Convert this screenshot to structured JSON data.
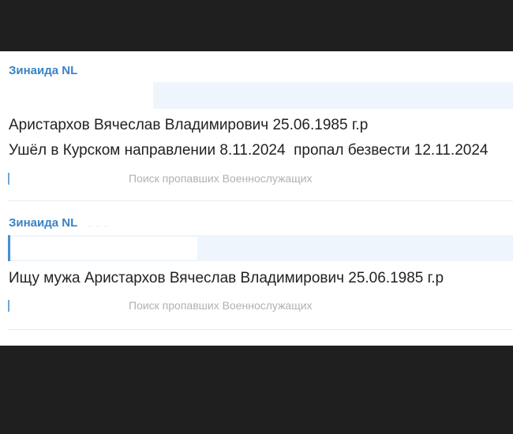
{
  "messages": [
    {
      "author": "Зинаида NL",
      "lines": [
        "Аристархов Вячеслав Владимирович 25.06.1985 г.р",
        "Ушёл в Курском направлении 8.11.2024  пропал безвести 12.11.2024"
      ],
      "source": "Поиск пропавших Военнослужащих"
    },
    {
      "author": "Зинаида NL",
      "lines": [
        "Ищу мужа Аристархов Вячеслав Владимирович 25.06.1985 г.р"
      ],
      "source": "Поиск пропавших Военнослужащих"
    }
  ],
  "colors": {
    "author": "#3a83c4",
    "quote_background": "#eef5fd",
    "quote_bar": "#4b8fd0"
  }
}
